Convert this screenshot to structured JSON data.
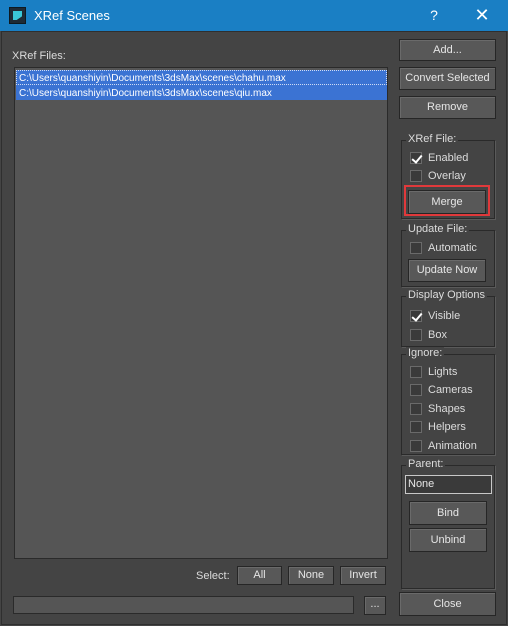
{
  "window": {
    "title": "XRef Scenes",
    "help_label": "?",
    "close_label": "✕"
  },
  "files": {
    "label": "XRef Files:",
    "items": [
      "C:\\Users\\quanshiyin\\Documents\\3dsMax\\scenes\\chahu.max",
      "C:\\Users\\quanshiyin\\Documents\\3dsMax\\scenes\\qiu.max"
    ]
  },
  "actions": {
    "add": "Add...",
    "convert": "Convert Selected",
    "remove": "Remove"
  },
  "xref_file": {
    "title": "XRef File:",
    "enabled": {
      "label": "Enabled",
      "checked": true
    },
    "overlay": {
      "label": "Overlay",
      "checked": false
    },
    "merge": "Merge"
  },
  "update_file": {
    "title": "Update File:",
    "automatic": {
      "label": "Automatic",
      "checked": false
    },
    "update_now": "Update Now"
  },
  "display_options": {
    "title": "Display Options",
    "visible": {
      "label": "Visible",
      "checked": true
    },
    "box": {
      "label": "Box",
      "checked": false
    }
  },
  "ignore": {
    "title": "Ignore:",
    "items": [
      {
        "label": "Lights",
        "checked": false
      },
      {
        "label": "Cameras",
        "checked": false
      },
      {
        "label": "Shapes",
        "checked": false
      },
      {
        "label": "Helpers",
        "checked": false
      },
      {
        "label": "Animation",
        "checked": false
      }
    ]
  },
  "parent": {
    "title": "Parent:",
    "value": "None",
    "bind": "Bind",
    "unbind": "Unbind"
  },
  "select": {
    "label": "Select:",
    "all": "All",
    "none": "None",
    "invert": "Invert"
  },
  "bottom": {
    "path_value": "",
    "browse": "...",
    "close": "Close"
  },
  "colors": {
    "titlebar": "#1a7fc4",
    "background": "#444444",
    "selection": "#3b73d3",
    "highlight_box": "#e0393b"
  }
}
